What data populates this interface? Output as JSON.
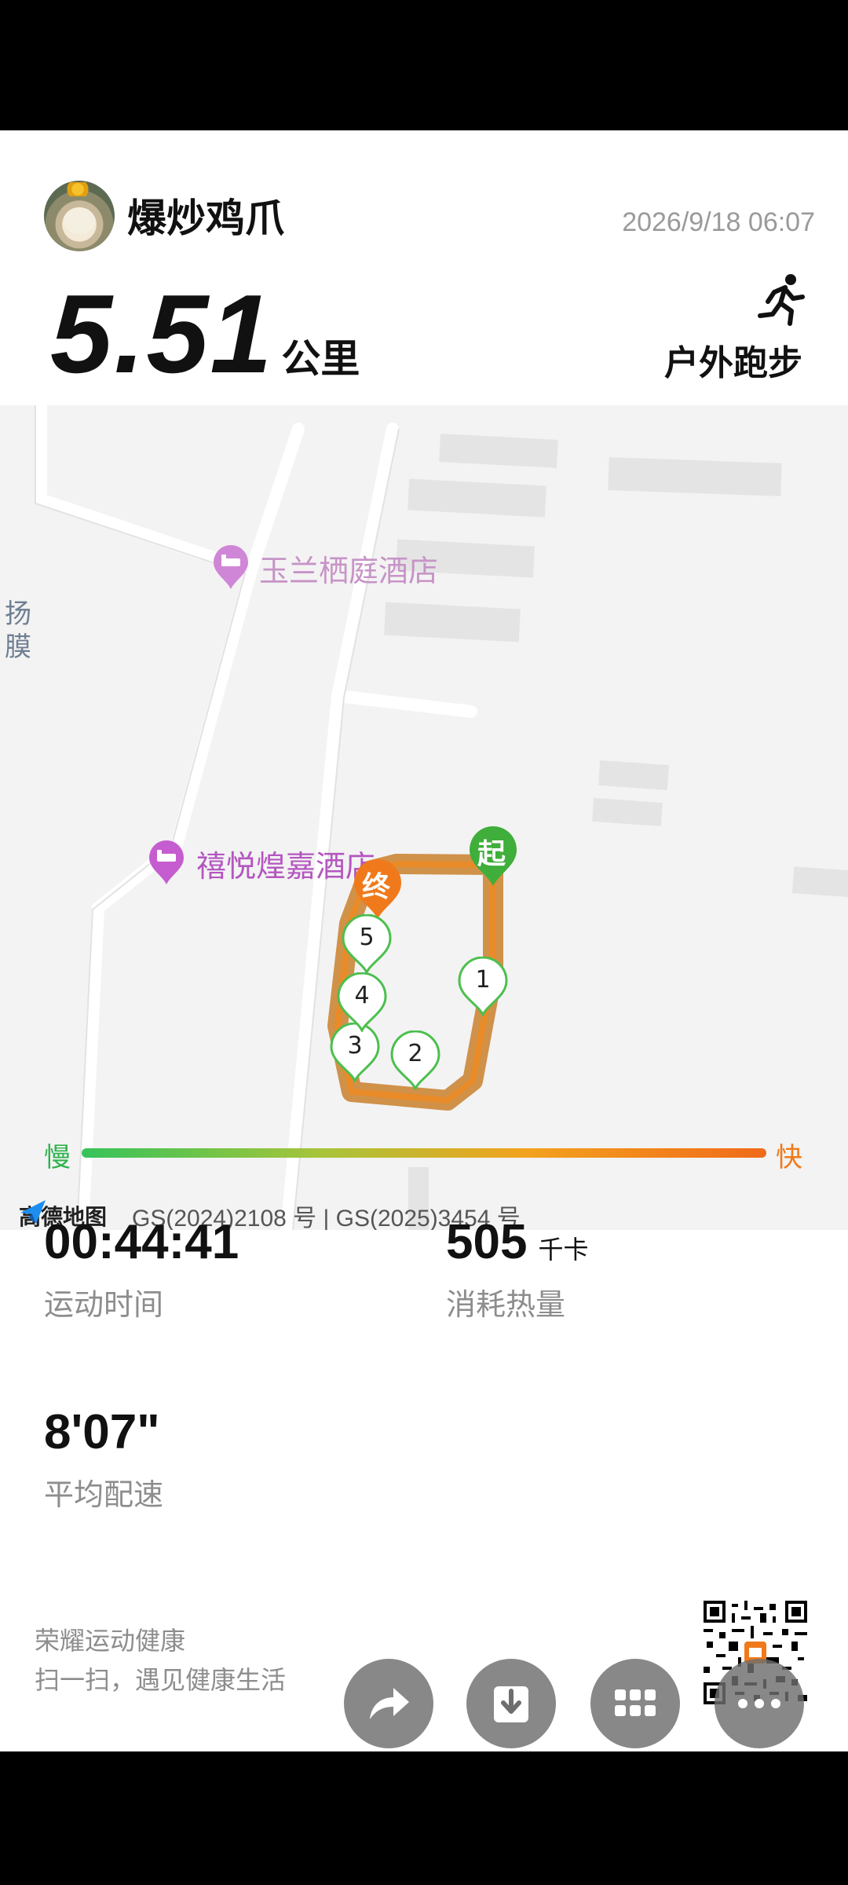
{
  "header": {
    "username": "爆炒鸡爪",
    "datetime": "2026/9/18 06:07",
    "distance_value": "5.51",
    "distance_unit": "公里",
    "activity_type": "户外跑步"
  },
  "map": {
    "poi_1": "玉兰栖庭酒店",
    "poi_2": "禧悦煌嘉酒店",
    "side_text_1": "扬",
    "side_text_2": "膜",
    "start_label": "起",
    "end_label": "终",
    "km_markers": [
      "1",
      "2",
      "3",
      "4",
      "5"
    ],
    "provider": "高德地图",
    "credit": "GS(2024)2108 号 | GS(2025)3454 号"
  },
  "speed_legend": {
    "slow": "慢",
    "fast": "快",
    "slow_color": "#35c35a",
    "fast_color": "#f06a1a"
  },
  "stats": {
    "duration_value": "00:44:41",
    "duration_label": "运动时间",
    "calories_value": "505",
    "calories_unit": "千卡",
    "calories_label": "消耗热量",
    "pace_value": "8'07\"",
    "pace_label": "平均配速"
  },
  "footer": {
    "brand": "荣耀运动健康",
    "slogan": "扫一扫，遇见健康生活",
    "actions": [
      "share-icon",
      "download-icon",
      "grid-icon",
      "more-icon"
    ]
  }
}
